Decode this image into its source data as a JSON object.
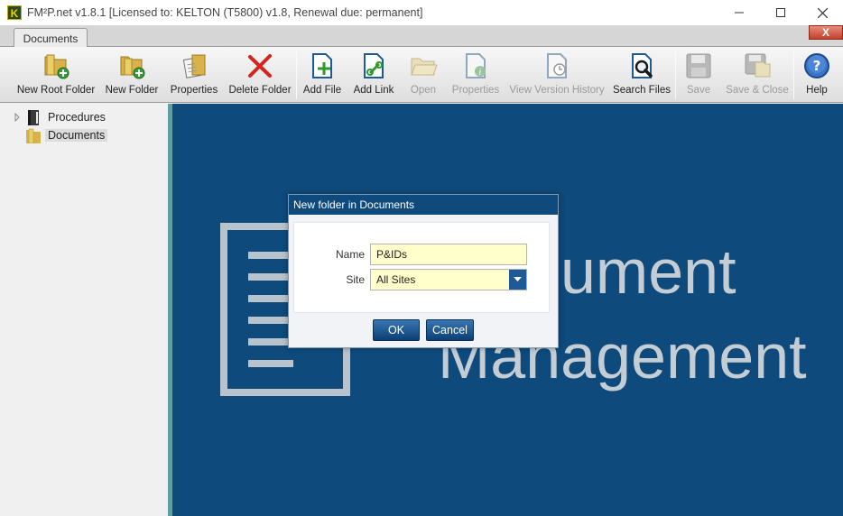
{
  "window": {
    "app_logo": "K",
    "title": "FM²P.net v1.8.1 [Licensed to: KELTON  (T5800) v1.8, Renewal due: permanent]",
    "minimize_icon": "minimize-icon",
    "maximize_icon": "maximize-icon",
    "close_icon": "close-icon"
  },
  "ribbon": {
    "tab_label": "Documents",
    "close_label": "X",
    "buttons": [
      {
        "label": "New Root Folder",
        "icon": "new-root-folder-icon",
        "enabled": true
      },
      {
        "label": "New Folder",
        "icon": "new-folder-icon",
        "enabled": true
      },
      {
        "label": "Properties",
        "icon": "properties-icon",
        "enabled": true
      },
      {
        "label": "Delete Folder",
        "icon": "delete-icon",
        "enabled": true
      },
      {
        "label": "Add File",
        "icon": "add-file-icon",
        "enabled": true
      },
      {
        "label": "Add Link",
        "icon": "add-link-icon",
        "enabled": true
      },
      {
        "label": "Open",
        "icon": "open-folder-icon",
        "enabled": false
      },
      {
        "label": "Properties",
        "icon": "file-properties-icon",
        "enabled": false
      },
      {
        "label": "View Version History",
        "icon": "version-history-icon",
        "enabled": false
      },
      {
        "label": "Search Files",
        "icon": "search-icon",
        "enabled": true
      },
      {
        "label": "Save",
        "icon": "save-icon",
        "enabled": false
      },
      {
        "label": "Save & Close",
        "icon": "save-close-icon",
        "enabled": false
      },
      {
        "label": "Help",
        "icon": "help-icon",
        "enabled": true
      }
    ]
  },
  "tree": {
    "items": [
      {
        "label": "Procedures",
        "icon": "binder-icon",
        "expandable": true,
        "selected": false
      },
      {
        "label": "Documents",
        "icon": "folder-icon",
        "expandable": false,
        "selected": true
      }
    ]
  },
  "watermark": {
    "line1": "ument",
    "line2": "Management"
  },
  "dialog": {
    "title": "New folder in Documents",
    "name_label": "Name",
    "name_value": "P&IDs",
    "site_label": "Site",
    "site_value": "All Sites",
    "ok_label": "OK",
    "cancel_label": "Cancel"
  },
  "colors": {
    "main_background": "#0e4a7c",
    "input_background": "#ffffcc",
    "splitter": "#5f9ea0"
  }
}
